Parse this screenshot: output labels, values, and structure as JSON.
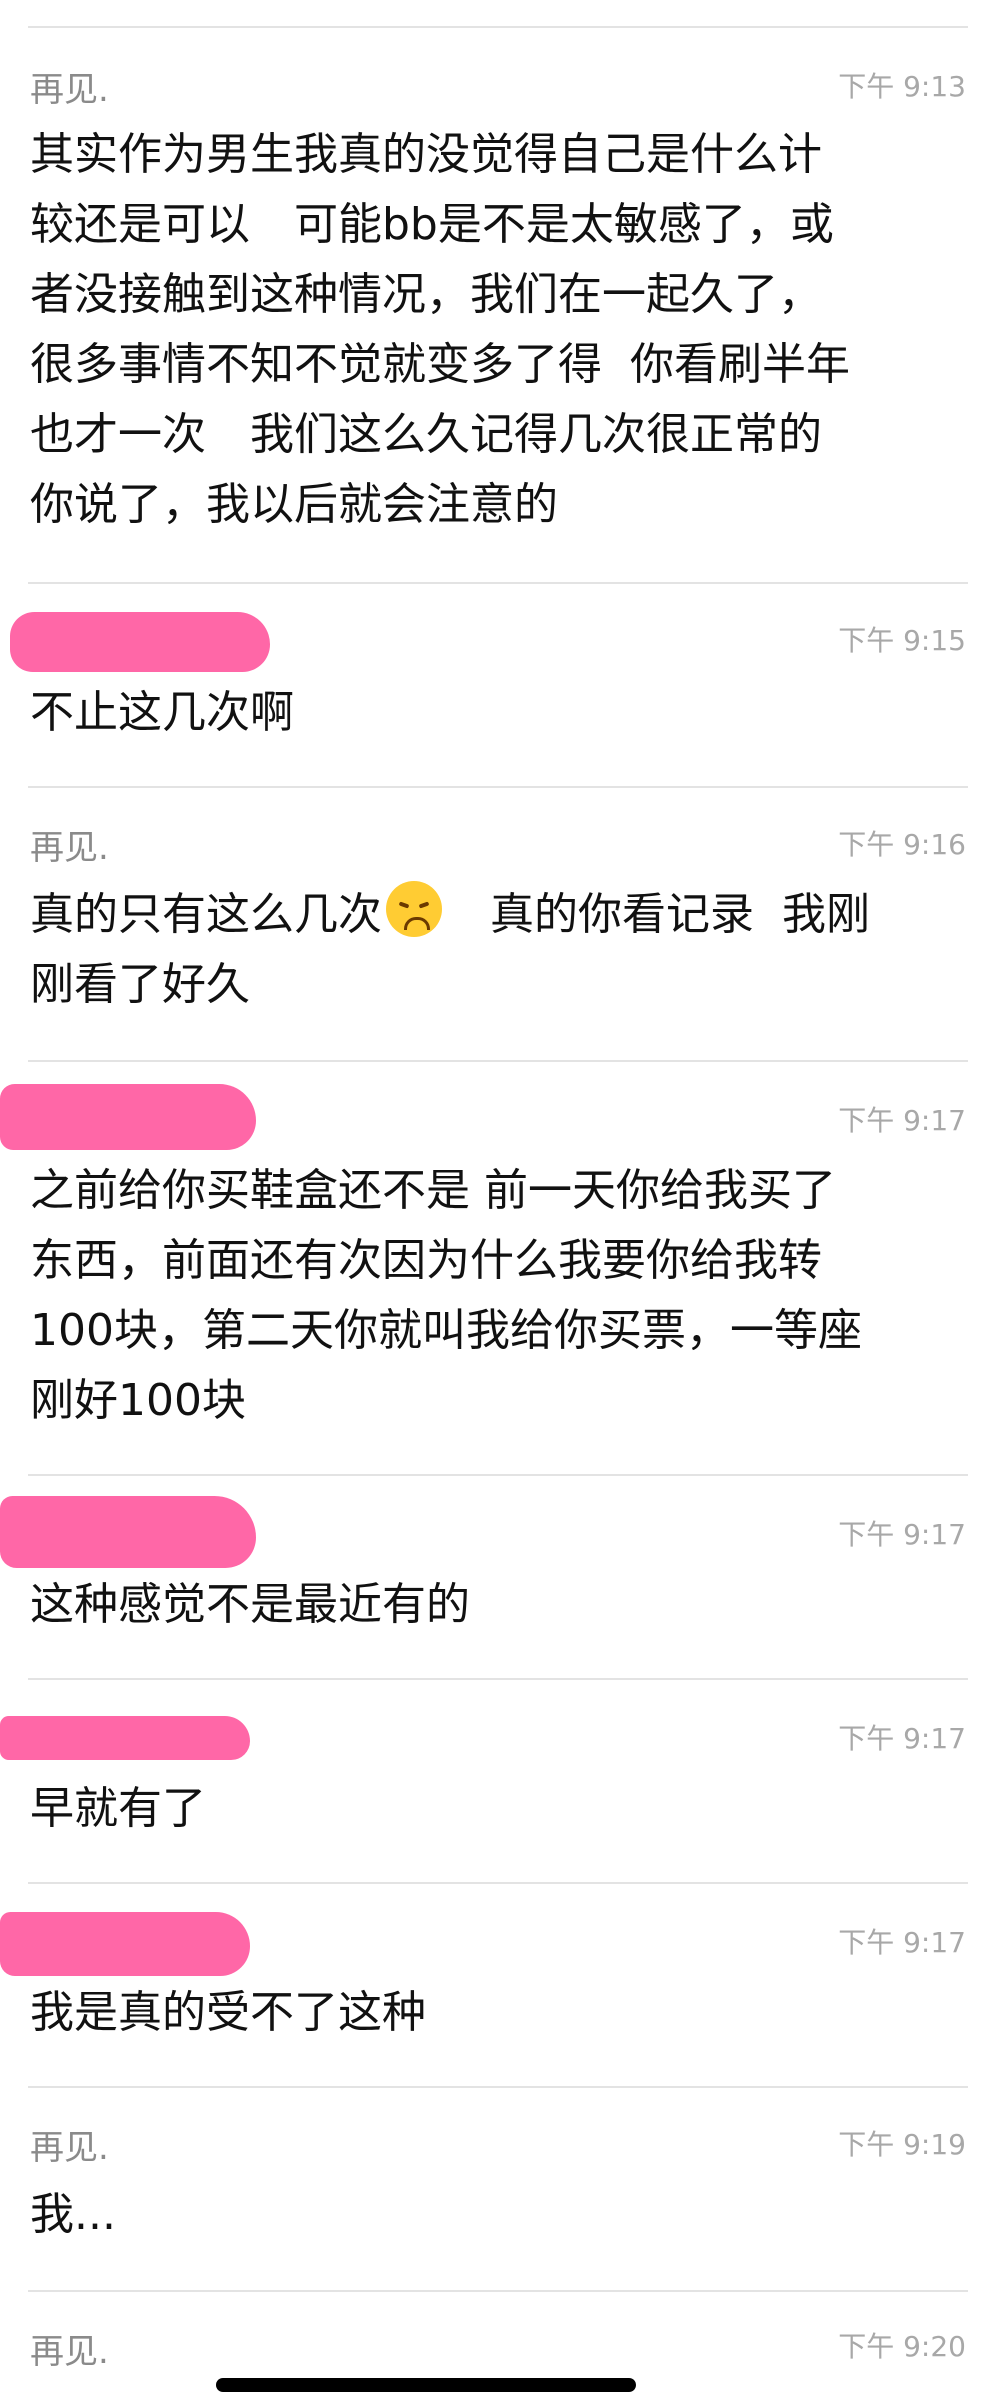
{
  "messages": [
    {
      "sender": "再见.",
      "time": "下午 9:13",
      "lines": [
        "其实作为男生我真的没觉得自己是什么计",
        "较还是可以　可能bb是不是太敏感了，或",
        "者没接触到这种情况，我们在一起久了，",
        "很多事情不知不觉就变多了得  你看刷半年",
        "也才一次　我们这么久记得几次很正常的",
        "你说了，我以后就会注意的"
      ]
    },
    {
      "sender": "",
      "time": "下午 9:15",
      "lines": [
        "不止这几次啊"
      ]
    },
    {
      "sender": "再见.",
      "time": "下午 9:16",
      "lines_emoji": {
        "before": "真的只有这么几次",
        "emoji": "disappointed-face",
        "after": "　真的你看记录  我刚"
      },
      "lines": [
        "刚看了好久"
      ]
    },
    {
      "sender": "",
      "time": "下午 9:17",
      "lines": [
        "之前给你买鞋盒还不是 前一天你给我买了",
        "东西，前面还有次因为什么我要你给我转",
        "100块，第二天你就叫我给你买票，一等座",
        "刚好100块"
      ]
    },
    {
      "sender": "",
      "time": "下午 9:17",
      "lines": [
        "这种感觉不是最近有的"
      ]
    },
    {
      "sender": "",
      "time": "下午 9:17",
      "lines": [
        "早就有了"
      ]
    },
    {
      "sender": "",
      "time": "下午 9:17",
      "lines": [
        "我是真的受不了这种"
      ]
    },
    {
      "sender": "再见.",
      "time": "下午 9:19",
      "lines": [
        "我..."
      ]
    },
    {
      "sender": "再见.",
      "time": "下午 9:20",
      "lines": []
    }
  ],
  "colors": {
    "redaction": "#ff5fa2",
    "divider": "#e3e3e3",
    "sender": "#8a8a8a",
    "time": "#a8a8a8",
    "text": "#111111"
  }
}
